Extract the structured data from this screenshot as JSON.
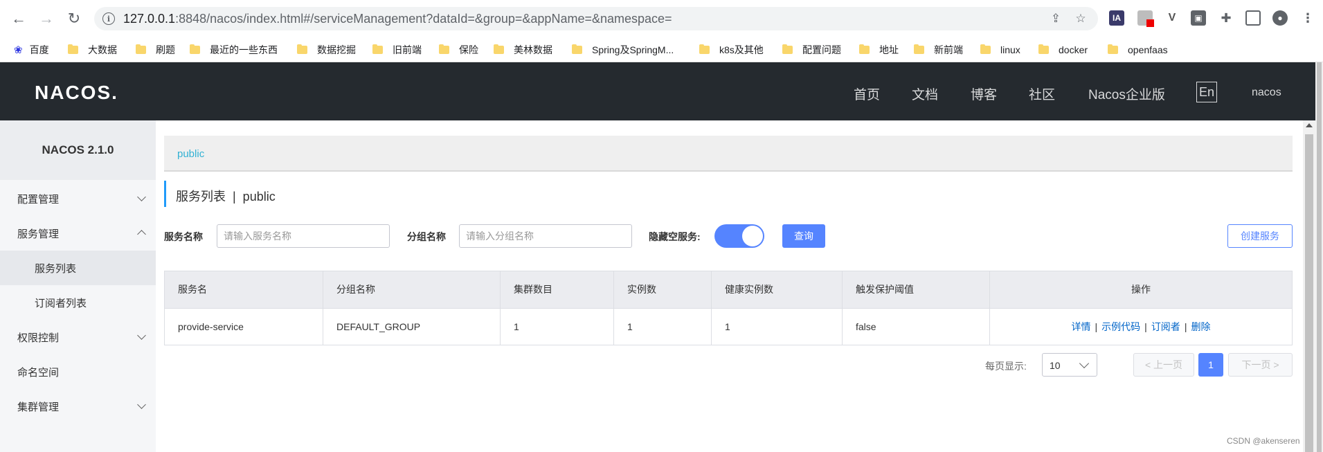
{
  "browser": {
    "url_host": "127.0.0.1",
    "url_rest": ":8848/nacos/index.html#/serviceManagement?dataId=&group=&appName=&namespace=",
    "bookmarks": [
      "百度",
      "大数据",
      "刷题",
      "最近的一些东西",
      "数据挖掘",
      "旧前端",
      "保险",
      "美林数据",
      "Spring及SpringM...",
      "k8s及其他",
      "配置问题",
      "地址",
      "新前端",
      "linux",
      "docker",
      "openfaas"
    ]
  },
  "header": {
    "logo": "NACOS.",
    "nav": [
      "首页",
      "文档",
      "博客",
      "社区",
      "Nacos企业版"
    ],
    "lang": "En",
    "user": "nacos"
  },
  "sidebar": {
    "version": "NACOS 2.1.0",
    "items": [
      {
        "label": "配置管理"
      },
      {
        "label": "服务管理"
      },
      {
        "label": "服务列表"
      },
      {
        "label": "订阅者列表"
      },
      {
        "label": "权限控制"
      },
      {
        "label": "命名空间"
      },
      {
        "label": "集群管理"
      }
    ]
  },
  "main": {
    "namespace_tab": "public",
    "page_title": "服务列表  |  public",
    "filters": {
      "service_label": "服务名称",
      "service_placeholder": "请输入服务名称",
      "group_label": "分组名称",
      "group_placeholder": "请输入分组名称",
      "hide_empty_label": "隐藏空服务:",
      "query_button": "查询",
      "create_button": "创建服务"
    },
    "table": {
      "headers": [
        "服务名",
        "分组名称",
        "集群数目",
        "实例数",
        "健康实例数",
        "触发保护阈值",
        "操作"
      ],
      "rows": [
        {
          "name": "provide-service",
          "group": "DEFAULT_GROUP",
          "clusters": "1",
          "instances": "1",
          "healthy": "1",
          "threshold": "false"
        }
      ],
      "actions": [
        "详情",
        "示例代码",
        "订阅者",
        "删除"
      ]
    },
    "pagination": {
      "page_size_label": "每页显示:",
      "page_size": "10",
      "prev": "上一页",
      "current": "1",
      "next": "下一页"
    }
  },
  "watermark": "CSDN @akenseren"
}
